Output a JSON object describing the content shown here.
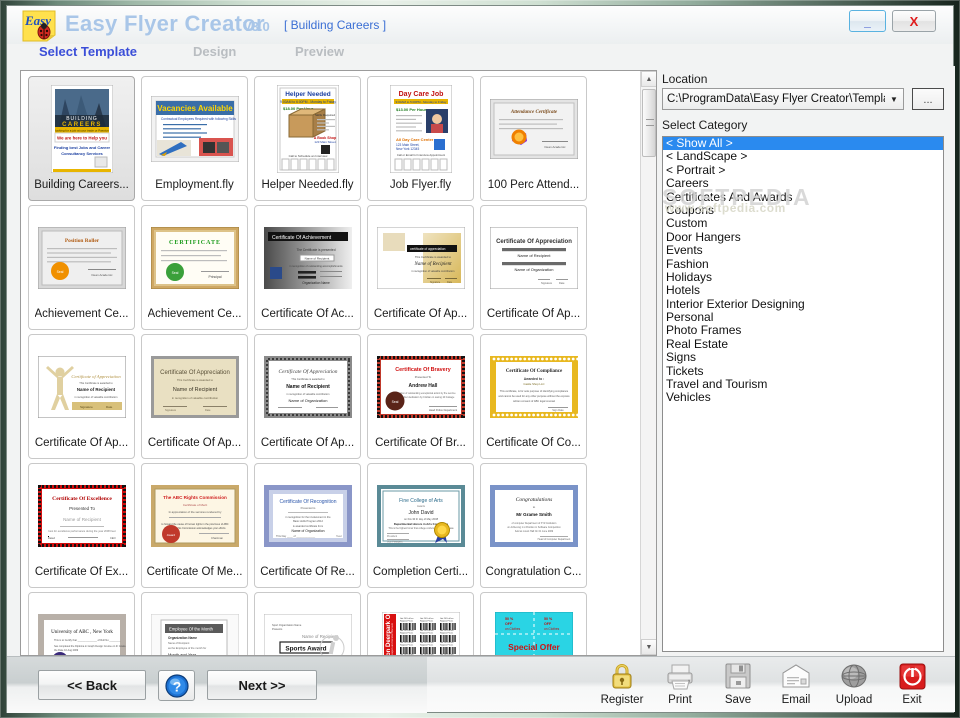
{
  "window": {
    "app_title": "Easy Flyer Creator",
    "version": "V3.0",
    "document_name": "[ Building Careers ]",
    "minimize_label": "_",
    "close_label": "X",
    "logo_text": "Easy"
  },
  "steps": [
    {
      "label": "Select Template",
      "state": "active"
    },
    {
      "label": "Design",
      "state": "inactive"
    },
    {
      "label": "Preview",
      "state": "inactive"
    }
  ],
  "side": {
    "location_label": "Location",
    "location_value": "C:\\ProgramData\\Easy Flyer Creator\\Templates",
    "browse_label": "...",
    "category_label": "Select Category",
    "categories": [
      "< Show All >",
      "< LandScape >",
      "< Portrait >",
      "Careers",
      "Certificates And Awards",
      "Coupons",
      "Custom",
      "Door Hangers",
      "Events",
      "Fashion",
      "Holidays",
      "Hotels",
      "Interior Exterior Designing",
      "Personal",
      "Photo Frames",
      "Real Estate",
      "Signs",
      "Tickets",
      "Travel and Tourism",
      "Vehicles"
    ],
    "selected_category": "< Show All >"
  },
  "watermark": {
    "line1": "SOFTPEDIA",
    "line2": "www.softpedia.com"
  },
  "templates": [
    {
      "name": "Building Careers...",
      "selected": true,
      "thumb": "building-careers",
      "title": "BUILDING CAREERS"
    },
    {
      "name": "Employment.fly",
      "selected": false,
      "thumb": "employment",
      "title": "Vacancies Available"
    },
    {
      "name": "Helper Needed.fly",
      "selected": false,
      "thumb": "helper-needed",
      "title": "Helper Needed"
    },
    {
      "name": "Job Flyer.fly",
      "selected": false,
      "thumb": "job-flyer",
      "title": "Day Care Job"
    },
    {
      "name": "100 Perc Attend...",
      "selected": false,
      "thumb": "attendance",
      "title": "Attendance Certificate"
    },
    {
      "name": "Achievement Ce...",
      "selected": false,
      "thumb": "achievement-1",
      "title": "Position Roller"
    },
    {
      "name": "Achievement Ce...",
      "selected": false,
      "thumb": "achievement-2",
      "title": "CERTIFICATE"
    },
    {
      "name": "Certificate Of Ac...",
      "selected": false,
      "thumb": "cert-achievement",
      "title": "Certificate Of Achievement"
    },
    {
      "name": "Certificate Of Ap...",
      "selected": false,
      "thumb": "cert-appr-gold",
      "title": "Certificate of Appreciation"
    },
    {
      "name": "Certificate Of Ap...",
      "selected": false,
      "thumb": "cert-appr-plain",
      "title": "Certificate Of Appreciation"
    },
    {
      "name": "Certificate Of Ap...",
      "selected": false,
      "thumb": "cert-appr-figure",
      "title": "Certificate of Appreciation"
    },
    {
      "name": "Certificate Of Ap...",
      "selected": false,
      "thumb": "cert-appr-tan",
      "title": "Certificate Of Appreciation"
    },
    {
      "name": "Certificate Of Ap...",
      "selected": false,
      "thumb": "cert-appr-dots",
      "title": "Certificate Of Appreciation"
    },
    {
      "name": "Certificate Of Br...",
      "selected": false,
      "thumb": "cert-bravery",
      "title": "Certificate Of Bravery"
    },
    {
      "name": "Certificate Of Co...",
      "selected": false,
      "thumb": "cert-compliance",
      "title": "Certificate Of Compliance"
    },
    {
      "name": "Certificate Of Ex...",
      "selected": false,
      "thumb": "cert-excellence",
      "title": "Certificate Of Excellence"
    },
    {
      "name": "Certificate Of Me...",
      "selected": false,
      "thumb": "cert-merit",
      "title": "The ABC Rights Commission"
    },
    {
      "name": "Certificate Of Re...",
      "selected": false,
      "thumb": "cert-recognition",
      "title": "Certificate Of Recognition"
    },
    {
      "name": "Completion Certi...",
      "selected": false,
      "thumb": "cert-completion",
      "title": "Fine College of Arts"
    },
    {
      "name": "Congratulation C...",
      "selected": false,
      "thumb": "cert-congrats",
      "title": "Congratulations"
    },
    {
      "name": "",
      "selected": false,
      "thumb": "cert-university",
      "title": "University of ABC , New York"
    },
    {
      "name": "",
      "selected": false,
      "thumb": "employee-month",
      "title": "Employee Of the Month"
    },
    {
      "name": "",
      "selected": false,
      "thumb": "sports-award",
      "title": "Sports Award"
    },
    {
      "name": "",
      "selected": false,
      "thumb": "barcode-coupon",
      "title": "Sale on Deerpark Outlet"
    },
    {
      "name": "",
      "selected": false,
      "thumb": "special-offer",
      "title": "Special Offer"
    }
  ],
  "scrollbar": {
    "up": "▲",
    "down": "▼"
  },
  "footer": {
    "back_label": "<< Back",
    "next_label": "Next >>",
    "help_label": "?",
    "tools": [
      {
        "label": "Register",
        "icon": "lock-icon"
      },
      {
        "label": "Print",
        "icon": "printer-icon"
      },
      {
        "label": "Save",
        "icon": "floppy-disk-icon"
      },
      {
        "label": "Email",
        "icon": "envelope-icon"
      },
      {
        "label": "Upload",
        "icon": "globe-icon"
      },
      {
        "label": "Exit",
        "icon": "power-icon"
      }
    ]
  },
  "colors": {
    "accent_blue": "#3b4ed8",
    "title_blue": "#a9c6e8",
    "selection_blue": "#2a8aef",
    "close_red": "#e01b1b",
    "frame_green": "#2f4238"
  }
}
